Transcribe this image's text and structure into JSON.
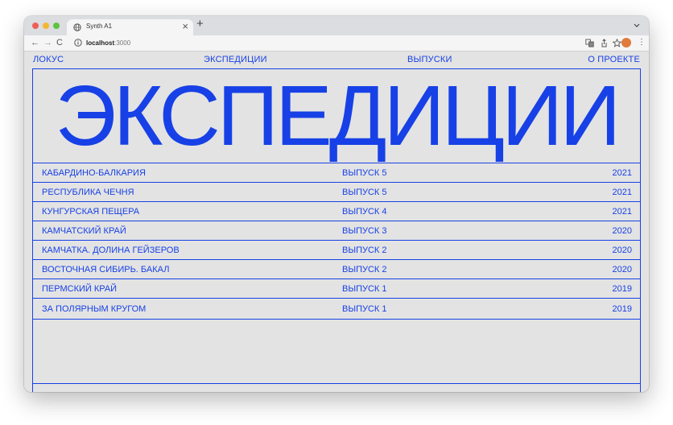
{
  "browser": {
    "tab_title": "Synth A1",
    "tab_close": "×",
    "new_tab": "+",
    "url_host": "localhost",
    "url_port": ":3000",
    "nav_back": "←",
    "nav_forward": "→",
    "nav_reload": "C",
    "menu": "⋮"
  },
  "site": {
    "nav": [
      "ЛОКУС",
      "ЭКСПЕДИЦИИ",
      "ВЫПУСКИ",
      "О ПРОЕКТЕ"
    ],
    "hero_title": "ЭКСПЕДИЦИИ",
    "rows": [
      {
        "name": "КАБАРДИНО-БАЛКАРИЯ",
        "issue": "ВЫПУСК 5",
        "year": "2021"
      },
      {
        "name": "РЕСПУБЛИКА ЧЕЧНЯ",
        "issue": "ВЫПУСК 5",
        "year": "2021"
      },
      {
        "name": "КУНГУРСКАЯ ПЕЩЕРА",
        "issue": "ВЫПУСК 4",
        "year": "2021"
      },
      {
        "name": "КАМЧАТСКИЙ КРАЙ",
        "issue": "ВЫПУСК 3",
        "year": "2020"
      },
      {
        "name": "КАМЧАТКА. ДОЛИНА ГЕЙЗЕРОВ",
        "issue": "ВЫПУСК 2",
        "year": "2020"
      },
      {
        "name": "ВОСТОЧНАЯ СИБИРЬ. БАКАЛ",
        "issue": "ВЫПУСК 2",
        "year": "2020"
      },
      {
        "name": "ПЕРМСКИЙ КРАЙ",
        "issue": "ВЫПУСК 1",
        "year": "2019"
      },
      {
        "name": "ЗА ПОЛЯРНЫМ КРУГОМ",
        "issue": "ВЫПУСК 1",
        "year": "2019"
      }
    ]
  },
  "colors": {
    "accent": "#1741e6",
    "page_background": "#e3e3e3",
    "avatar": "#e17a3a"
  },
  "icons": {
    "tab_favicon": "globe-icon",
    "site_info": "info-icon",
    "tab_list": "chevron-down-icon",
    "translate": "translate-icon",
    "share": "share-icon",
    "bookmark": "star-icon",
    "side_panel": "side-panel-icon"
  }
}
